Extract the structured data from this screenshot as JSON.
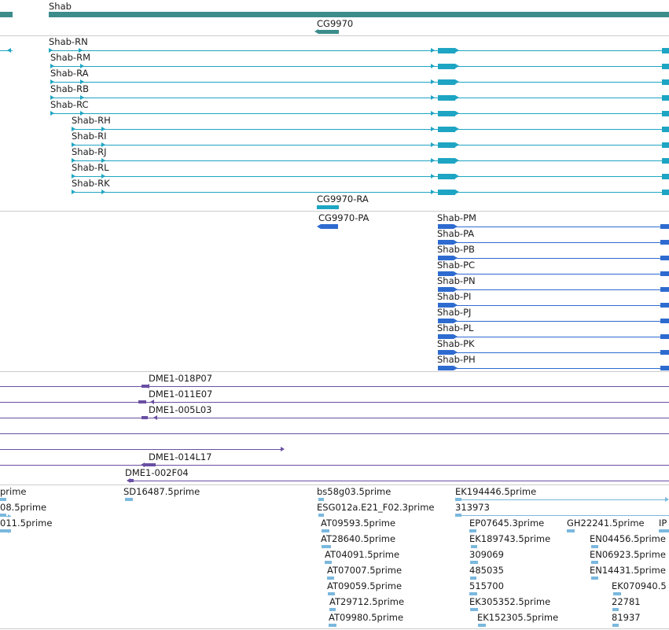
{
  "colors": {
    "gene": "#3c8c8c",
    "transcript": "#1ea5c3",
    "protein": "#2e6bd0",
    "clone": "#6a4fa3",
    "est": "#7ab8de",
    "separator": "#cccccc"
  },
  "genes": {
    "shab": "Shab",
    "cg9970": "CG9970"
  },
  "transcripts": {
    "rn": "Shab-RN",
    "rm": "Shab-RM",
    "ra": "Shab-RA",
    "rb": "Shab-RB",
    "rc": "Shab-RC",
    "rh": "Shab-RH",
    "ri": "Shab-RI",
    "rj": "Shab-RJ",
    "rl": "Shab-RL",
    "rk": "Shab-RK",
    "cg9970_ra": "CG9970-RA"
  },
  "proteins": {
    "cg9970_pa": "CG9970-PA",
    "pm": "Shab-PM",
    "pa": "Shab-PA",
    "pb": "Shab-PB",
    "pc": "Shab-PC",
    "pn": "Shab-PN",
    "pi": "Shab-PI",
    "pj": "Shab-PJ",
    "pl": "Shab-PL",
    "pk": "Shab-PK",
    "ph": "Shab-PH"
  },
  "clones": {
    "c1": "DME1-018P07",
    "c2": "DME1-011E07",
    "c3": "DME1-005L03",
    "c4": "DME1-014L17",
    "c5": "DME1-002F04"
  },
  "ests": {
    "e1": "prime",
    "e2": "08.5prime",
    "e3": "011.5prime",
    "e4": "SD16487.5prime",
    "e5": "bs58g03.5prime",
    "e6": "ESG012a.E21_F02.3prime",
    "e7": "AT09593.5prime",
    "e8": "AT28640.5prime",
    "e9": "AT04091.5prime",
    "e10": "AT07007.5prime",
    "e11": "AT09059.5prime",
    "e12": "AT29712.5prime",
    "e13": "AT09980.5prime",
    "e14": "EK194446.5prime",
    "e15": "313973",
    "e16": "EP07645.3prime",
    "e17": "EK189743.5prime",
    "e18": "309069",
    "e19": "485035",
    "e20": "515700",
    "e21": "EK305352.5prime",
    "e22": "EK152305.5prime",
    "e23": "GH22241.5prime",
    "e24": "IP",
    "e25": "EN04456.5prime",
    "e26": "EN06923.5prime",
    "e27": "EN14431.5prime",
    "e28": "EK070940.5",
    "e29": "22781",
    "e30": "81937"
  }
}
